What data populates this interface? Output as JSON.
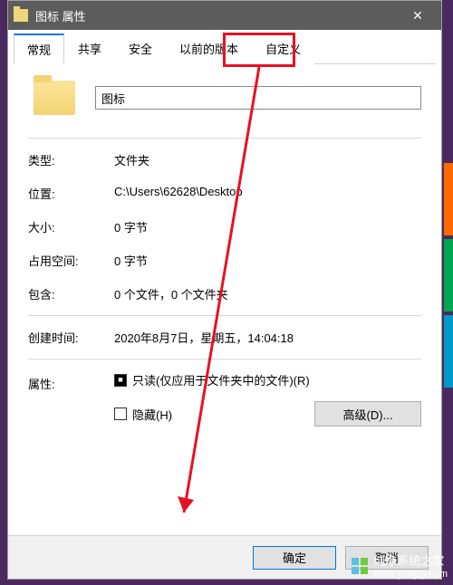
{
  "titlebar": {
    "title": "图标 属性"
  },
  "tabs": [
    "常规",
    "共享",
    "安全",
    "以前的版本",
    "自定义"
  ],
  "active_tab_index": 0,
  "folder_name": "图标",
  "rows": {
    "type": {
      "label": "类型:",
      "value": "文件夹"
    },
    "location": {
      "label": "位置:",
      "value": "C:\\Users\\62628\\Desktop"
    },
    "size": {
      "label": "大小:",
      "value": "0 字节"
    },
    "size_on_disk": {
      "label": "占用空间:",
      "value": "0 字节"
    },
    "contains": {
      "label": "包含:",
      "value": "0 个文件，0 个文件夹"
    },
    "created": {
      "label": "创建时间:",
      "value": "2020年8月7日，星期五，14:04:18"
    }
  },
  "attributes": {
    "label": "属性:",
    "readonly": "只读(仅应用于文件夹中的文件)(R)",
    "hidden": "隐藏(H)",
    "advanced": "高级(D)..."
  },
  "buttons": {
    "ok": "确定",
    "cancel": "取消"
  },
  "watermark": {
    "text": "纯净系统之家",
    "url": "www.ycwjzy.com"
  }
}
